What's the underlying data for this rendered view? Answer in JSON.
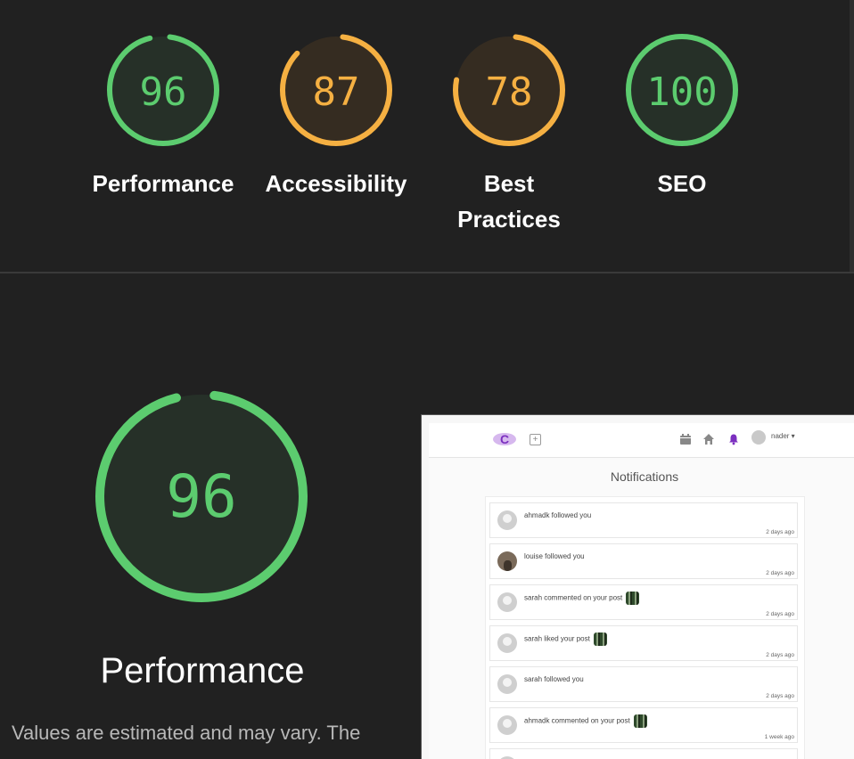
{
  "top_scores": [
    {
      "value": "96",
      "label_lines": [
        "Performance"
      ],
      "fraction": 0.96,
      "status": "pass"
    },
    {
      "value": "87",
      "label_lines": [
        "Accessibility"
      ],
      "fraction": 0.87,
      "status": "average"
    },
    {
      "value": "78",
      "label_lines": [
        "Best",
        "Practices"
      ],
      "fraction": 0.78,
      "status": "average"
    },
    {
      "value": "100",
      "label_lines": [
        "SEO"
      ],
      "fraction": 1.0,
      "status": "pass"
    }
  ],
  "main_score": {
    "value": "96",
    "label": "Performance",
    "fraction": 0.96,
    "status": "pass"
  },
  "description": "Values are estimated and may vary. The",
  "colors": {
    "pass": "#5ccc6f",
    "pass_bg": "#263028",
    "average": "#f5b042",
    "average_bg": "#352c21",
    "background": "#212121"
  },
  "preview": {
    "logo_letter": "C",
    "add_icon": "plus-square-icon",
    "nav_icons": [
      "calendar-icon",
      "home-icon",
      "bell-icon"
    ],
    "user_name": "nader ▾",
    "page_title": "Notifications",
    "notifications": [
      {
        "text": "ahmadk followed you",
        "time": "2 days ago",
        "avatar": "default",
        "thumb": false
      },
      {
        "text": "louise followed you",
        "time": "2 days ago",
        "avatar": "photo",
        "thumb": false
      },
      {
        "text": "sarah commented on your post",
        "time": "2 days ago",
        "avatar": "default",
        "thumb": true
      },
      {
        "text": "sarah liked your post",
        "time": "2 days ago",
        "avatar": "default",
        "thumb": true
      },
      {
        "text": "sarah followed you",
        "time": "2 days ago",
        "avatar": "default",
        "thumb": false
      },
      {
        "text": "ahmadk commented on your post",
        "time": "1 week ago",
        "avatar": "default",
        "thumb": true
      }
    ]
  }
}
